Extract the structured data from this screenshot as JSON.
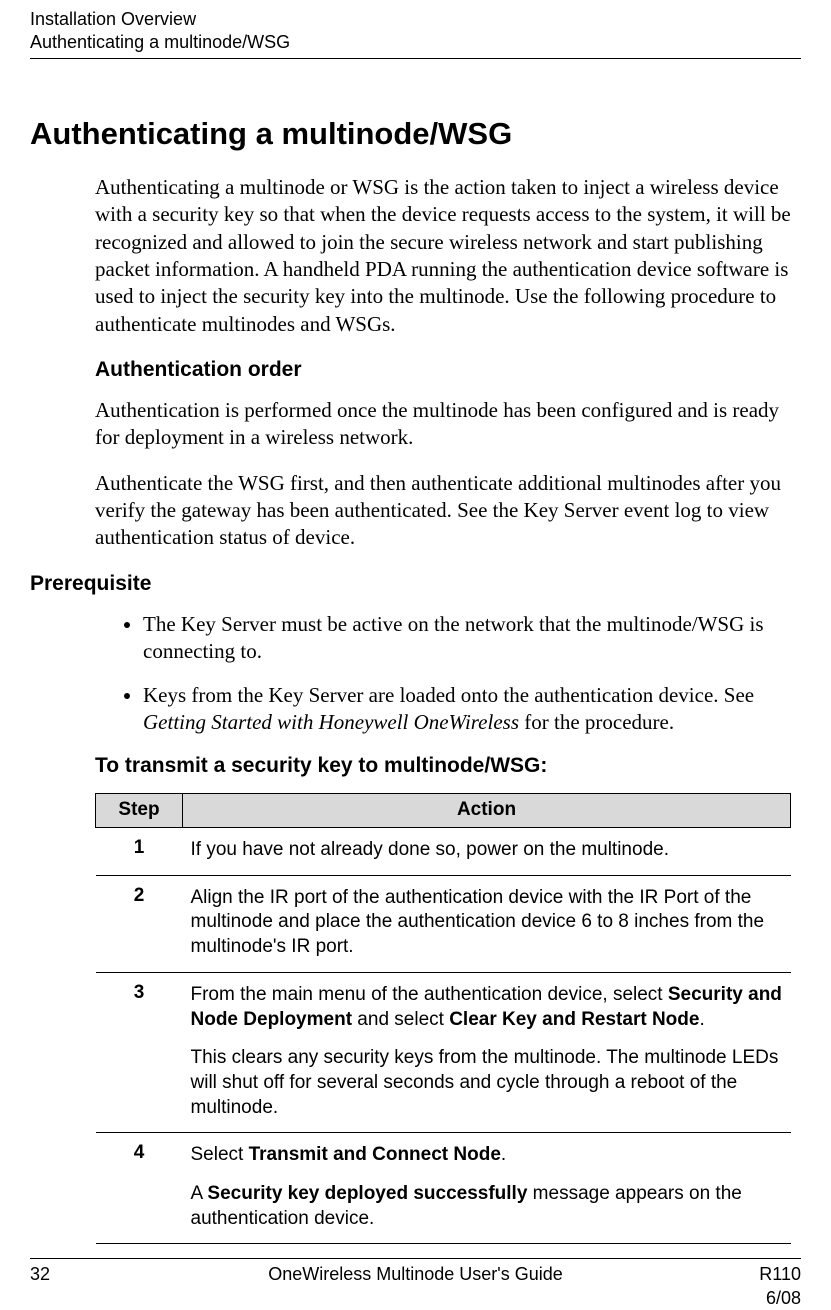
{
  "header": {
    "line1": "Installation Overview",
    "line2": "Authenticating a multinode/WSG"
  },
  "title": "Authenticating a multinode/WSG",
  "intro": "Authenticating a multinode or WSG is the action taken to inject a wireless device with a security key so that when the device requests access to the system, it will be recognized and allowed to join the secure wireless network and start publishing packet information. A handheld PDA running the authentication device software is used to inject the security key into the multinode. Use the following procedure to authenticate multinodes and WSGs.",
  "auth_order_heading": "Authentication order",
  "auth_order_p1": "Authentication is performed once the multinode has been configured and is ready for deployment in a wireless network.",
  "auth_order_p2": "Authenticate the WSG first, and then authenticate additional multinodes after you verify the gateway has been authenticated. See the Key Server event log to view authentication status of device.",
  "prereq_heading": "Prerequisite",
  "prereqs": {
    "b1": "The Key Server must be active on the network that the multinode/WSG is connecting to.",
    "b2_pre": "Keys from the Key Server are loaded onto the authentication device.  See ",
    "b2_italic": "Getting Started with Honeywell OneWireless",
    "b2_post": " for the procedure."
  },
  "transmit_heading": "To transmit a security key to multinode/WSG:",
  "table": {
    "col1": "Step",
    "col2": "Action",
    "rows": {
      "r1": {
        "num": "1",
        "p1": "If you have not already done so, power on the multinode."
      },
      "r2": {
        "num": "2",
        "p1": "Align the IR port of the authentication device with the IR Port of the multinode and place the authentication device 6 to 8 inches from the multinode's IR port."
      },
      "r3": {
        "num": "3",
        "p1_pre": "From the main menu of the authentication device, select ",
        "p1_b1": "Security and Node Deployment",
        "p1_mid": " and select ",
        "p1_b2": "Clear Key and Restart Node",
        "p1_post": ".",
        "p2": "This clears any security keys from the multinode. The multinode LEDs will shut off for several seconds and cycle through a reboot of the multinode."
      },
      "r4": {
        "num": "4",
        "p1_pre": "Select ",
        "p1_b1": "Transmit and Connect Node",
        "p1_post": ".",
        "p2_pre": "A ",
        "p2_b1": "Security key deployed successfully",
        "p2_post": " message appears on the authentication device."
      }
    }
  },
  "footer": {
    "page_num": "32",
    "center": "OneWireless Multinode User's Guide",
    "rev": "R110",
    "date": "6/08"
  }
}
